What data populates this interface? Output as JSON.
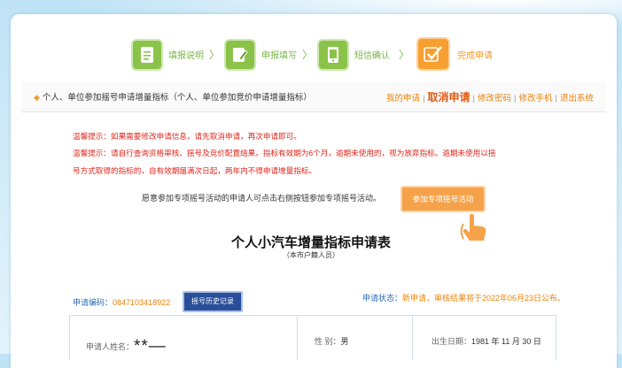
{
  "steps": [
    {
      "label": "填报说明",
      "icon": "document-icon"
    },
    {
      "label": "申报填写",
      "icon": "edit-icon"
    },
    {
      "label": "短信确认",
      "icon": "phone-icon"
    },
    {
      "label": "完成申请",
      "icon": "check-icon"
    }
  ],
  "step_arrow": "〉",
  "header": {
    "title": "个人、单位参加摇号申请增量指标（个人、单位参加竞价申请增量指标）",
    "links": {
      "my_apply": "我的申请",
      "cancel_apply": "取消申请",
      "change_password": "修改密码",
      "change_phone": "修改手机",
      "logout": "退出系统",
      "sep": "|"
    }
  },
  "warnings": [
    "温馨提示：如果需要修改申请信息，请先取消申请，再次申请即可。",
    "温馨提示：请自行查询资格审核、摇号及竞价配置结果。指标有效期为6个月，逾期未使用的，视为放弃指标。逾期未使用以摇",
    "号方式取得的指标的，自有效期届满次日起，两年内不得申请增量指标。"
  ],
  "special": {
    "notice": "愿意参加专项摇号活动的申请人可点击右侧按钮参加专项摇号活动。",
    "button": "参加专项摇号活动"
  },
  "form": {
    "title": "个人小汽车增量指标申请表",
    "subtitle": "（本市户籍人员）",
    "code_label": "申请编码：",
    "code_value": "0847103418922",
    "history_button": "摇号历史记录",
    "status_label": "申请状态：",
    "status_value": "新申请，审核结果将于2022年06月23日公布。",
    "applicant_label": "申请人姓名：",
    "applicant_value": "**—",
    "gender_label": "性  别：",
    "gender_value": "男",
    "birth_label": "出生日期：",
    "birth_value": "1981 年 11 月 30 日"
  },
  "colors": {
    "step_green": "#8bc34a",
    "step_orange": "#f7a031",
    "warning_red": "#e0251a",
    "link_orange": "#e8840e",
    "history_blue": "#2a4f9a"
  }
}
